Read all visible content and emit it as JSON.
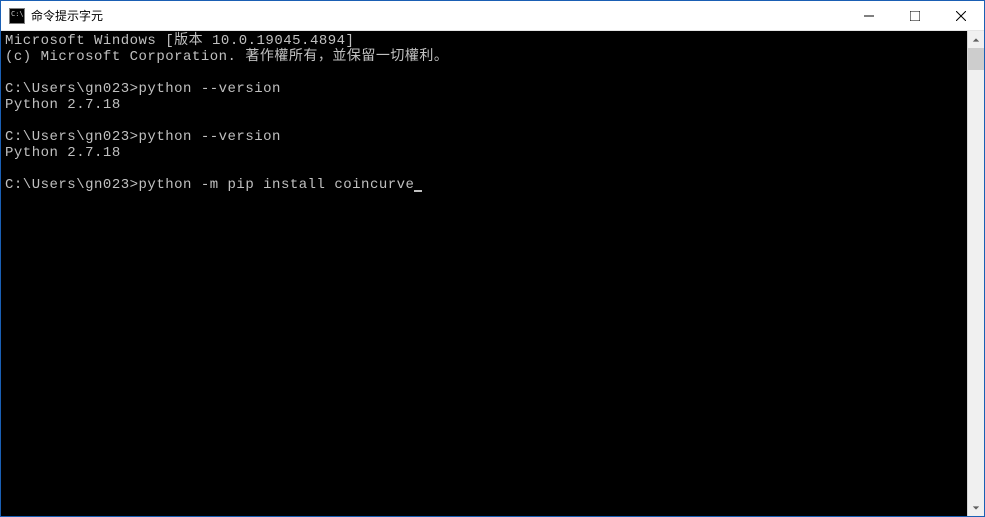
{
  "window": {
    "title": "命令提示字元"
  },
  "terminal": {
    "lines": [
      "Microsoft Windows [版本 10.0.19045.4894]",
      "(c) Microsoft Corporation. 著作權所有，並保留一切權利。",
      "",
      "C:\\Users\\gn023>python --version",
      "Python 2.7.18",
      "",
      "C:\\Users\\gn023>python --version",
      "Python 2.7.18",
      "",
      "C:\\Users\\gn023>python -m pip install coincurve"
    ]
  }
}
